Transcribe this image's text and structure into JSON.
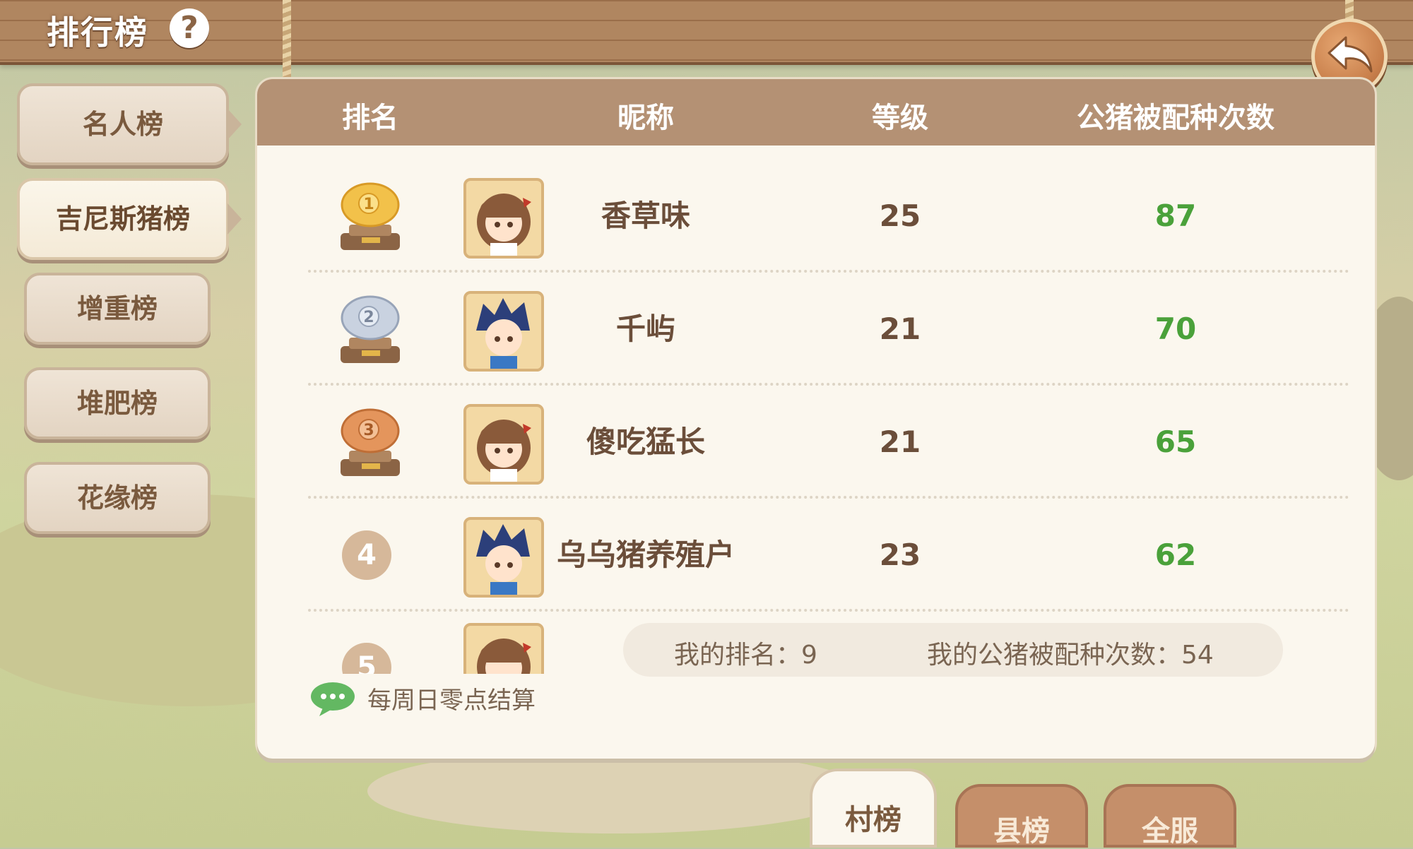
{
  "header": {
    "title": "排行榜"
  },
  "sidebar": {
    "items": [
      {
        "label": "名人榜"
      },
      {
        "label": "吉尼斯猪榜"
      },
      {
        "label": "增重榜"
      },
      {
        "label": "堆肥榜"
      },
      {
        "label": "花缘榜"
      }
    ],
    "active_index": 1
  },
  "table": {
    "columns": [
      "排名",
      "昵称",
      "等级",
      "公猪被配种次数"
    ],
    "rows": [
      {
        "rank": "1",
        "name": "香草味",
        "level": "25",
        "count": "87",
        "trophy": "gold-pig-trophy"
      },
      {
        "rank": "2",
        "name": "千屿",
        "level": "21",
        "count": "70",
        "trophy": "silver-pig-trophy"
      },
      {
        "rank": "3",
        "name": "傻吃猛长",
        "level": "21",
        "count": "65",
        "trophy": "bronze-pig-trophy"
      },
      {
        "rank": "4",
        "name": "乌乌猪养殖户",
        "level": "23",
        "count": "62"
      },
      {
        "rank": "5"
      }
    ]
  },
  "my_stats": {
    "rank_text": "我的排名：9",
    "count_text": "我的公猪被配种次数：54"
  },
  "notice": "每周日零点结算",
  "tabs": [
    {
      "label": "村榜"
    },
    {
      "label": "县榜"
    },
    {
      "label": "全服"
    }
  ],
  "colors": {
    "accent_green": "#4aa13a",
    "header_brown": "#b49174",
    "text_brown": "#6b4e3a"
  }
}
